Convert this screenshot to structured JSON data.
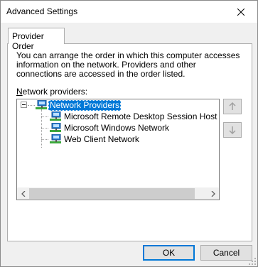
{
  "window": {
    "title": "Advanced Settings"
  },
  "tabs": [
    {
      "label": "Provider Order"
    }
  ],
  "panel": {
    "description": "You can arrange the order in which this computer accesses information on the network.  Providers and other connections are accessed in the order listed.",
    "providers_label_mnemonic": "N",
    "providers_label_rest": "etwork providers:"
  },
  "tree": {
    "root": {
      "label": "Network Providers"
    },
    "items": [
      {
        "label": "Microsoft Remote Desktop Session Host Server Network"
      },
      {
        "label": "Microsoft Windows Network"
      },
      {
        "label": "Web Client Network"
      }
    ]
  },
  "buttons": {
    "ok": "OK",
    "cancel": "Cancel"
  },
  "colors": {
    "selection": "#0078d7",
    "icon_monitor": "#2a7fd4",
    "icon_plug": "#3ca83c"
  },
  "icons": {
    "close": "close-icon",
    "move_up": "arrow-up-icon",
    "move_down": "arrow-down-icon",
    "scroll_left": "chevron-left-icon",
    "scroll_right": "chevron-right-icon",
    "network": "network-icon"
  }
}
